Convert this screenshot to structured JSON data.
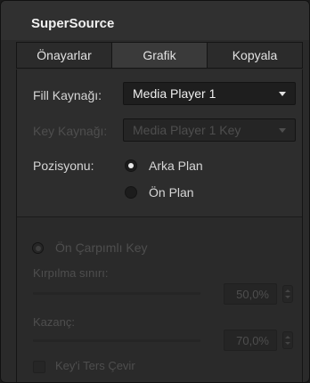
{
  "panel": {
    "title": "SuperSource"
  },
  "tabs": [
    {
      "label": "Önayarlar",
      "active": false
    },
    {
      "label": "Grafik",
      "active": true
    },
    {
      "label": "Kopyala",
      "active": false
    }
  ],
  "fill_source": {
    "label": "Fill Kaynağı:",
    "value": "Media Player 1"
  },
  "key_source": {
    "label": "Key Kaynağı:",
    "value": "Media Player 1 Key",
    "enabled": false
  },
  "position": {
    "label": "Pozisyonu:",
    "options": [
      {
        "label": "Arka Plan",
        "selected": true
      },
      {
        "label": "Ön Plan",
        "selected": false
      }
    ]
  },
  "premultiplied_key": {
    "label": "Ön Çarpımlı Key",
    "enabled": false,
    "selected": true
  },
  "clip": {
    "label": "Kırpılma sınırı:",
    "value": "50,0%",
    "level": 0.5
  },
  "gain": {
    "label": "Kazanç:",
    "value": "70,0%",
    "level": 0.7
  },
  "invert_key": {
    "label": "Key'i Ters Çevir",
    "checked": false
  },
  "colors": {
    "panel_bg": "#2a2a2a",
    "text": "#d8d8d8",
    "disabled_text": "#4e4e4e",
    "field_bg": "#1e1e1e"
  }
}
